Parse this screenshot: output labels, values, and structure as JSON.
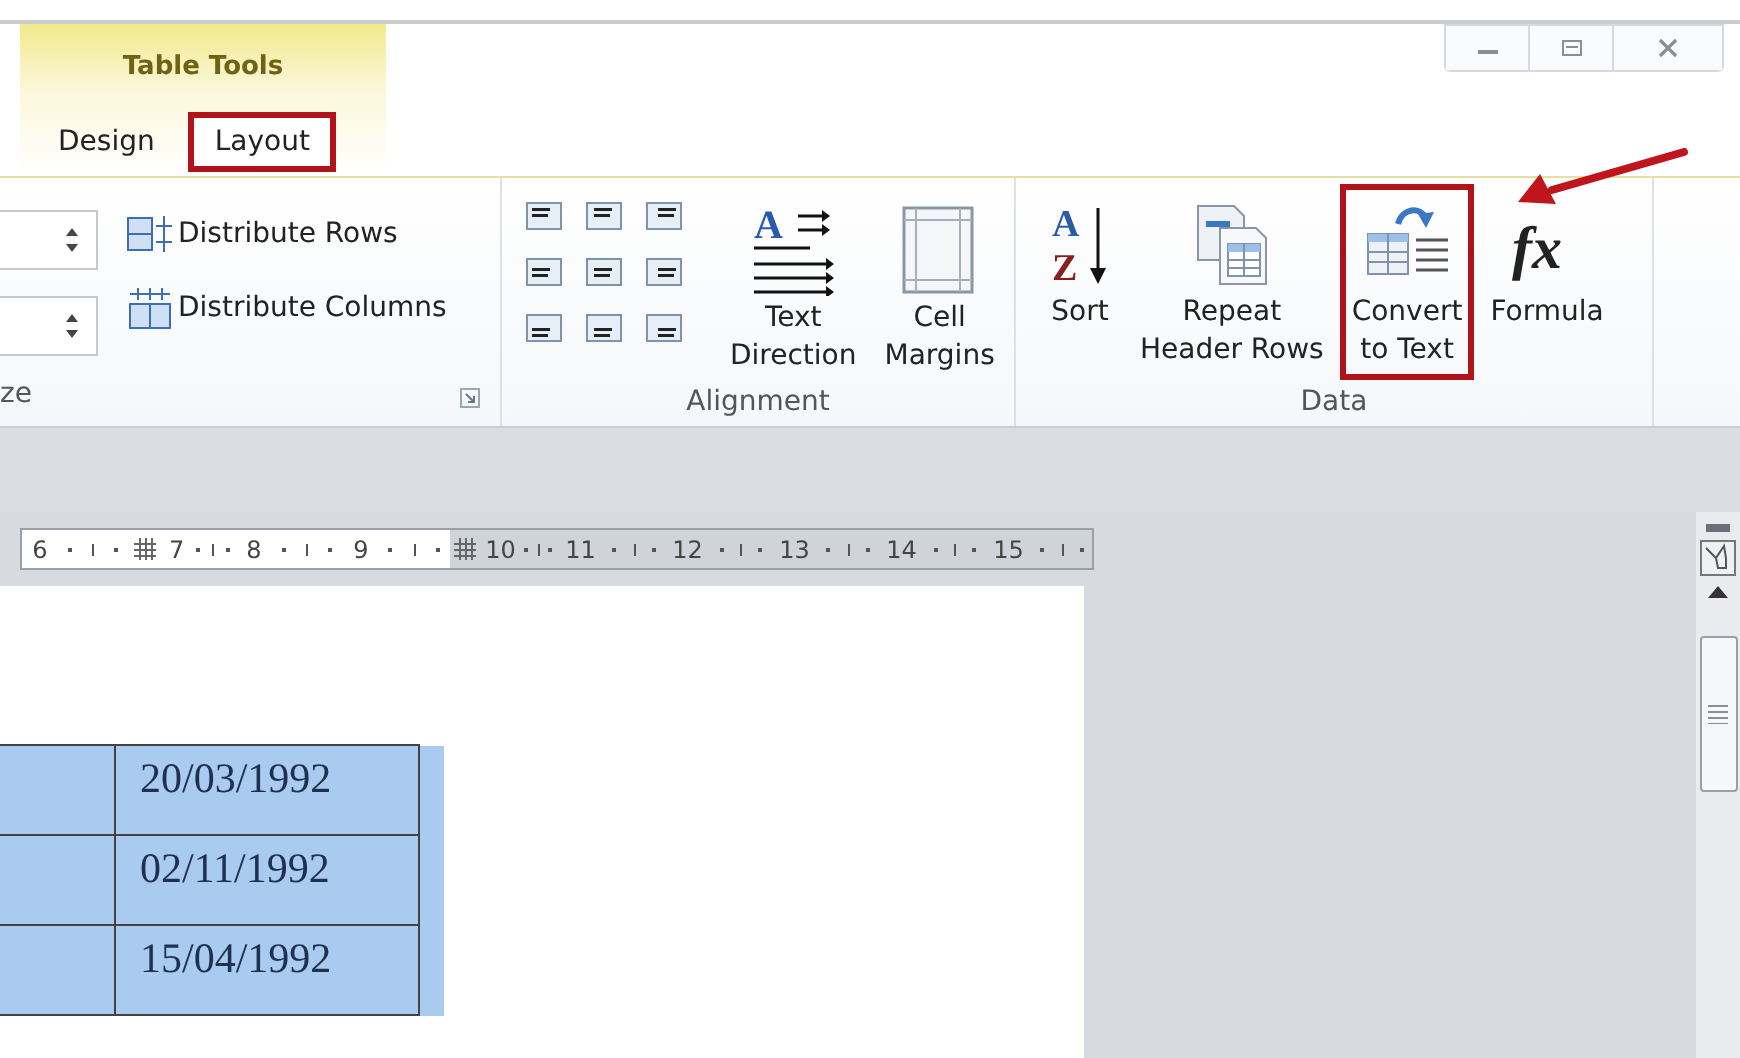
{
  "contextual_tab_group": {
    "title": "Table Tools"
  },
  "tabs": [
    {
      "label": "Design",
      "selected": false,
      "highlighted": false
    },
    {
      "label": "Layout",
      "selected": true,
      "highlighted": true
    }
  ],
  "cell_size_group": {
    "label": "ze",
    "items": [
      {
        "label": "Distribute Rows",
        "kind": "rows"
      },
      {
        "label": "Distribute Columns",
        "kind": "columns"
      }
    ]
  },
  "alignment_group": {
    "label": "Alignment",
    "buttons": [
      {
        "lines": [
          "Text",
          "Direction"
        ],
        "kind": "text-direction",
        "glyphs": [
          "A"
        ],
        "highlighted": false
      },
      {
        "lines": [
          "Cell",
          "Margins"
        ],
        "kind": "cell-margins",
        "highlighted": false
      }
    ]
  },
  "data_group": {
    "label": "Data",
    "buttons": [
      {
        "lines": [
          "Sort"
        ],
        "kind": "sort",
        "glyphs": [
          "A",
          "Z"
        ],
        "highlighted": false
      },
      {
        "lines": [
          "Repeat",
          "Header Rows"
        ],
        "kind": "repeat-header",
        "highlighted": false
      },
      {
        "lines": [
          "Convert",
          "to Text"
        ],
        "kind": "convert",
        "highlighted": true
      },
      {
        "lines": [
          "Formula"
        ],
        "kind": "formula",
        "glyphs": [
          "fx"
        ],
        "highlighted": false
      }
    ]
  },
  "ruler": {
    "numbers": [
      "6",
      "7",
      "8",
      "9",
      "10",
      "11",
      "12",
      "13",
      "14",
      "15"
    ]
  },
  "table": {
    "rows": [
      {
        "cells": [
          "",
          "20/03/1992"
        ],
        "selected": true
      },
      {
        "cells": [
          "",
          "02/11/1992"
        ],
        "selected": true
      },
      {
        "cells": [
          "",
          "15/04/1992"
        ],
        "selected": true
      }
    ]
  }
}
